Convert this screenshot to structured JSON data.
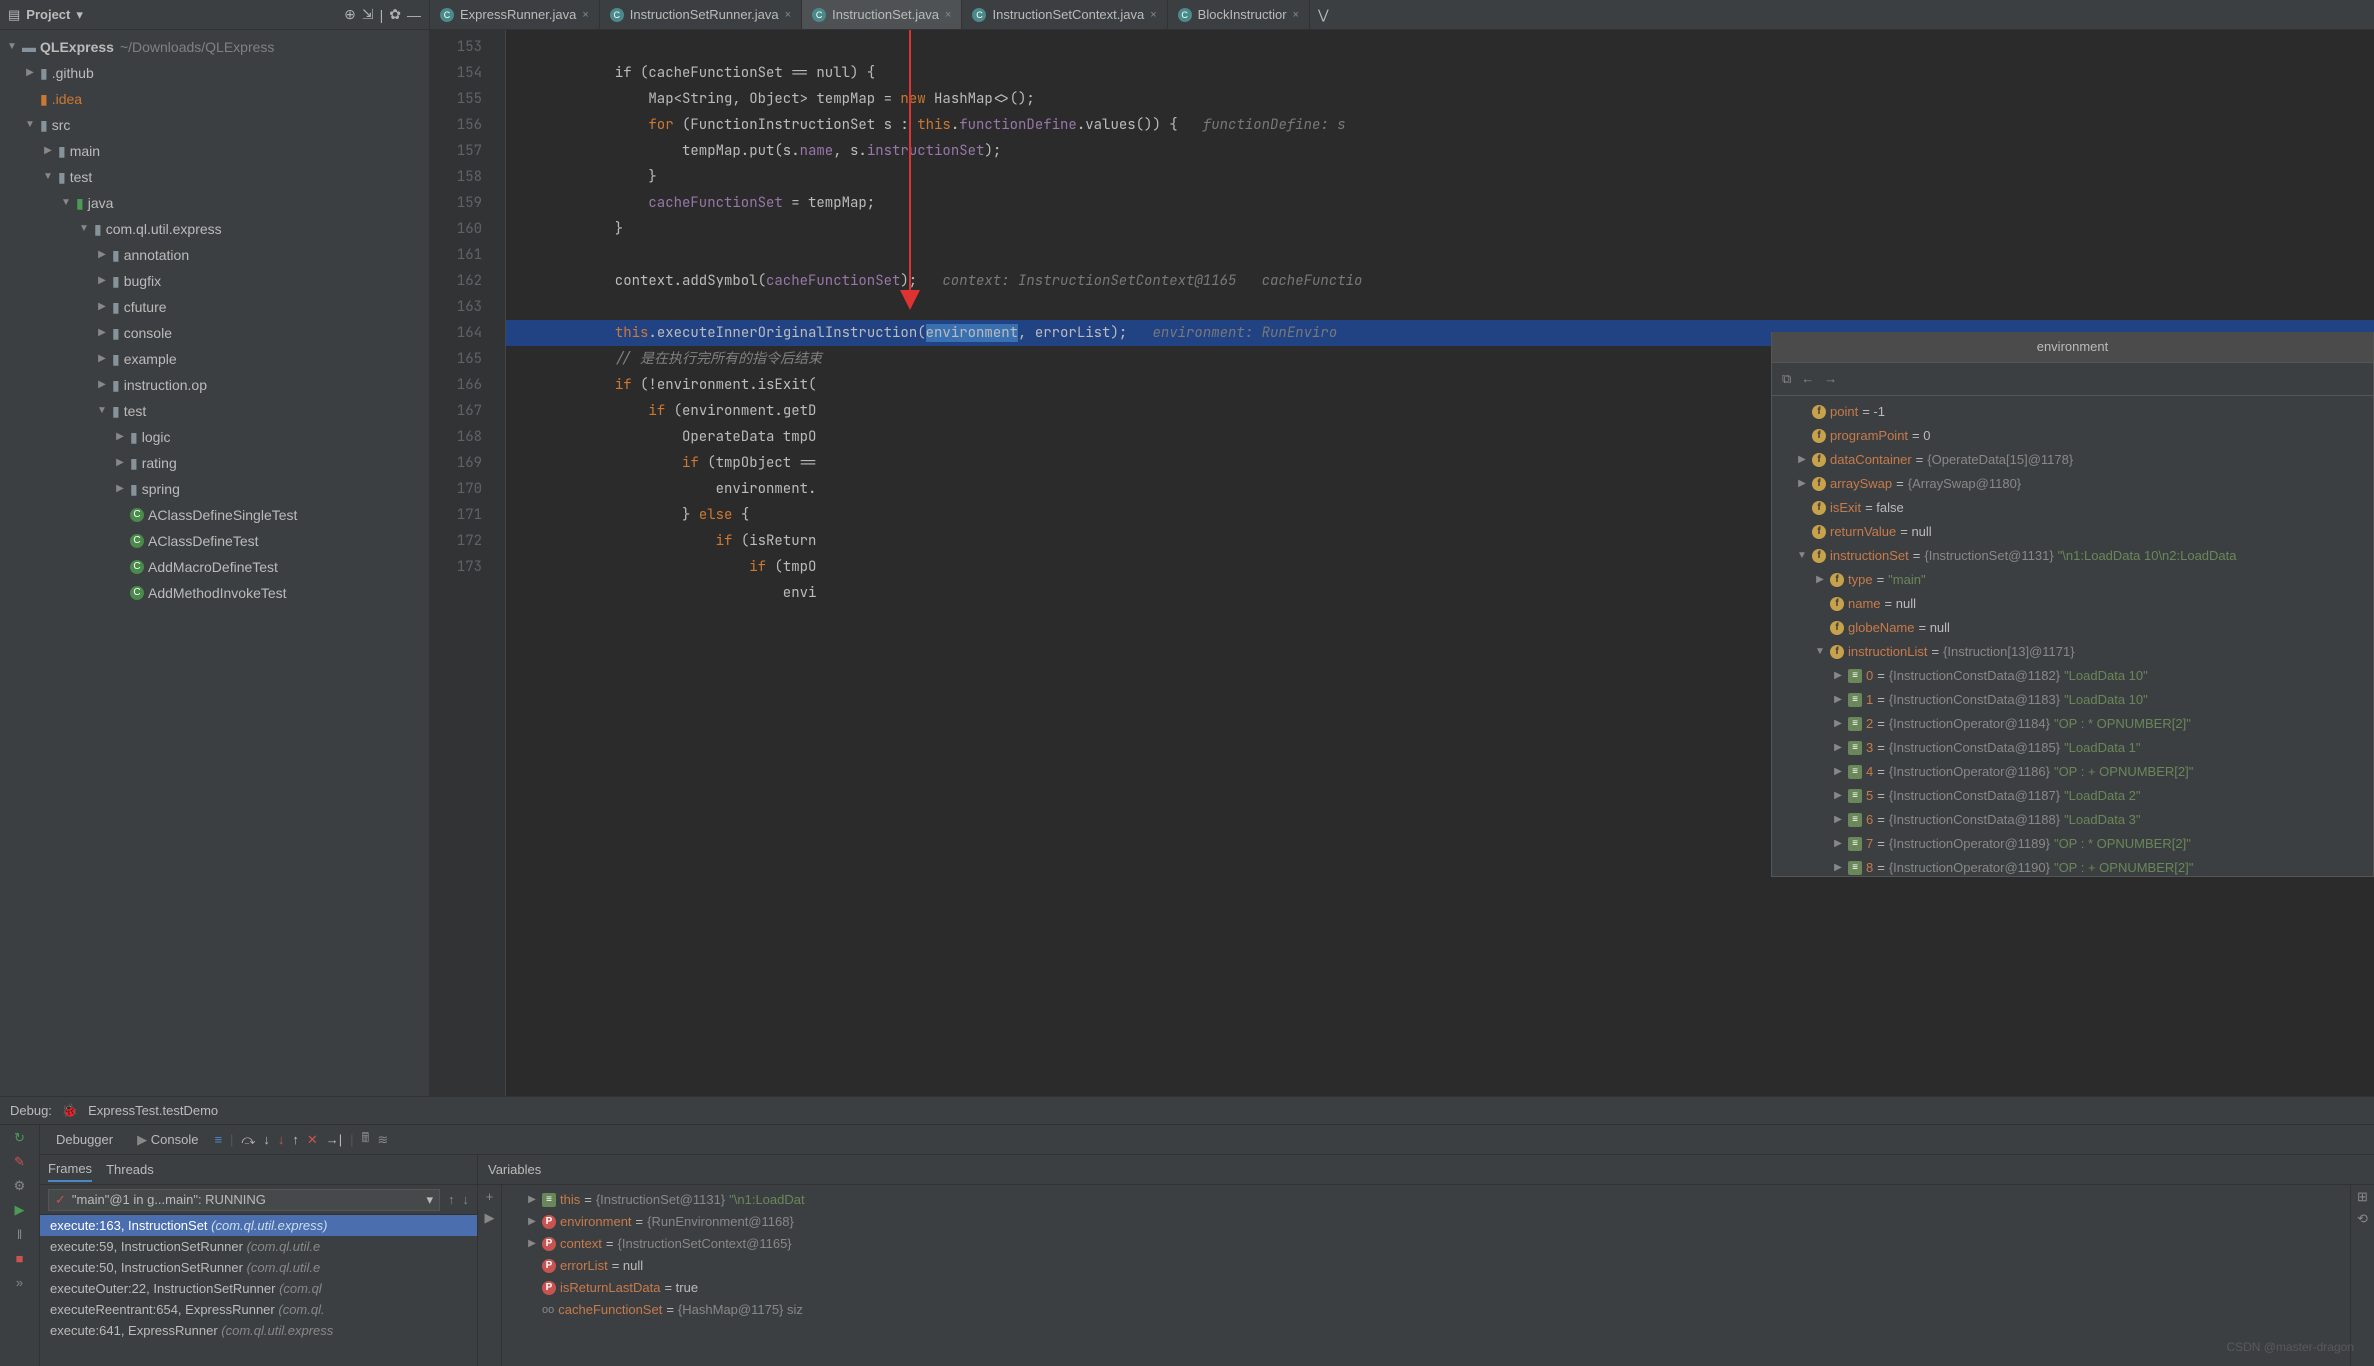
{
  "project": {
    "title": "Project",
    "root": "QLExpress",
    "rootPath": "~/Downloads/QLExpress",
    "tree": [
      {
        "indent": 1,
        "arrow": "▶",
        "icon": "folder",
        "name": ".github"
      },
      {
        "indent": 1,
        "arrow": "",
        "icon": "folder-idea",
        "name": ".idea"
      },
      {
        "indent": 1,
        "arrow": "▼",
        "icon": "folder",
        "name": "src"
      },
      {
        "indent": 2,
        "arrow": "▶",
        "icon": "folder",
        "name": "main"
      },
      {
        "indent": 2,
        "arrow": "▼",
        "icon": "folder",
        "name": "test"
      },
      {
        "indent": 3,
        "arrow": "▼",
        "icon": "folder-test",
        "name": "java"
      },
      {
        "indent": 4,
        "arrow": "▼",
        "icon": "folder",
        "name": "com.ql.util.express"
      },
      {
        "indent": 5,
        "arrow": "▶",
        "icon": "folder",
        "name": "annotation"
      },
      {
        "indent": 5,
        "arrow": "▶",
        "icon": "folder",
        "name": "bugfix"
      },
      {
        "indent": 5,
        "arrow": "▶",
        "icon": "folder",
        "name": "cfuture"
      },
      {
        "indent": 5,
        "arrow": "▶",
        "icon": "folder",
        "name": "console"
      },
      {
        "indent": 5,
        "arrow": "▶",
        "icon": "folder",
        "name": "example"
      },
      {
        "indent": 5,
        "arrow": "▶",
        "icon": "folder",
        "name": "instruction.op"
      },
      {
        "indent": 5,
        "arrow": "▼",
        "icon": "folder",
        "name": "test"
      },
      {
        "indent": 6,
        "arrow": "▶",
        "icon": "folder",
        "name": "logic"
      },
      {
        "indent": 6,
        "arrow": "▶",
        "icon": "folder",
        "name": "rating"
      },
      {
        "indent": 6,
        "arrow": "▶",
        "icon": "folder",
        "name": "spring"
      },
      {
        "indent": 6,
        "arrow": "",
        "icon": "class",
        "name": "AClassDefineSingleTest"
      },
      {
        "indent": 6,
        "arrow": "",
        "icon": "class",
        "name": "AClassDefineTest"
      },
      {
        "indent": 6,
        "arrow": "",
        "icon": "class",
        "name": "AddMacroDefineTest"
      },
      {
        "indent": 6,
        "arrow": "",
        "icon": "class",
        "name": "AddMethodInvokeTest"
      }
    ]
  },
  "tabs": [
    {
      "label": "ExpressRunner.java",
      "active": false
    },
    {
      "label": "InstructionSetRunner.java",
      "active": false
    },
    {
      "label": "InstructionSet.java",
      "active": true
    },
    {
      "label": "InstructionSetContext.java",
      "active": false
    },
    {
      "label": "BlockInstructior",
      "active": false
    }
  ],
  "gutter": [
    "153",
    "154",
    "155",
    "156",
    "157",
    "158",
    "159",
    "160",
    "161",
    "162",
    "163",
    "164",
    "165",
    "166",
    "167",
    "168",
    "169",
    "170",
    "171",
    "172",
    "173"
  ],
  "code": {
    "l153": "            if (cacheFunctionSet == null) {",
    "l154_a": "                Map<String, Object> tempMap ",
    "l154_b": "= ",
    "l154_c": "new",
    "l154_d": " HashMap<>();",
    "l155_a": "                ",
    "l155_b": "for",
    "l155_c": " (FunctionInstructionSet",
    "l155_d": " s : ",
    "l155_e": "this",
    "l155_f": ".",
    "l155_g": "functionDefine",
    "l155_h": ".values()) {   ",
    "l155_i": "functionDefine: s",
    "l156_a": "                    tempMap.put(s.",
    "l156_b": "name",
    "l156_c": ", s.",
    "l156_d": "instructionSet",
    "l156_e": ");",
    "l157": "                }",
    "l158_a": "                ",
    "l158_b": "cacheFunctionSet",
    "l158_c": " = tempMap;",
    "l159": "            }",
    "l160": "",
    "l161_a": "            context.addSymbol(",
    "l161_b": "cacheFunctionSet",
    "l161_c": ");   ",
    "l161_d": "context: InstructionSetContext@1165   cacheFunctio",
    "l162": "",
    "l163_a": "            ",
    "l163_b": "this",
    "l163_c": ".executeInnerOriginalInstruction(",
    "l163_d": "environment",
    "l163_e": ", errorList",
    "l163_f": ");   ",
    "l163_g": "environment: RunEnviro",
    "l164_a": "            ",
    "l164_b": "// 是在执行完所有的指令后结束",
    "l165_a": "            ",
    "l165_b": "if",
    "l165_c": " (!environment.isExit(",
    "l166_a": "                ",
    "l166_b": "if",
    "l166_c": " (environment.getD",
    "l167": "                    OperateData tmpO",
    "l168_a": "                    ",
    "l168_b": "if",
    "l168_c": " (tmpObject ==",
    "l169": "                        environment.",
    "l170_a": "                    } ",
    "l170_b": "else",
    "l170_c": " {",
    "l171_a": "                        ",
    "l171_b": "if",
    "l171_c": " (isReturn",
    "l172_a": "                            ",
    "l172_b": "if",
    "l172_c": " (tmpO",
    "l173": "                                envi"
  },
  "popup": {
    "title": "environment",
    "rows": [
      {
        "i": 1,
        "arr": "",
        "b": "f",
        "name": "point",
        "val": " = -1"
      },
      {
        "i": 1,
        "arr": "",
        "b": "f",
        "name": "programPoint",
        "val": " = 0"
      },
      {
        "i": 1,
        "arr": "▶",
        "b": "f",
        "name": "dataContainer",
        "val": " = ",
        "gr": "{OperateData[15]@1178}"
      },
      {
        "i": 1,
        "arr": "▶",
        "b": "f",
        "name": "arraySwap",
        "val": " = ",
        "gr": "{ArraySwap@1180}"
      },
      {
        "i": 1,
        "arr": "",
        "b": "f",
        "name": "isExit",
        "val": " = false"
      },
      {
        "i": 1,
        "arr": "",
        "b": "f",
        "name": "returnValue",
        "val": " = null",
        "flag": true
      },
      {
        "i": 1,
        "arr": "▼",
        "b": "f",
        "name": "instructionSet",
        "val": " = ",
        "gr": "{InstructionSet@1131} ",
        "sv": "\"\\n1:LoadData 10\\n2:LoadData"
      },
      {
        "i": 2,
        "arr": "▶",
        "b": "f",
        "name": "type",
        "val": " = ",
        "sv": "\"main\""
      },
      {
        "i": 2,
        "arr": "",
        "b": "f",
        "name": "name",
        "val": " = null"
      },
      {
        "i": 2,
        "arr": "",
        "b": "f",
        "name": "globeName",
        "val": " = null"
      },
      {
        "i": 2,
        "arr": "▼",
        "b": "f",
        "name": "instructionList",
        "val": " = ",
        "gr": "{Instruction[13]@1171}"
      },
      {
        "i": 3,
        "arr": "▶",
        "b": "e",
        "name": "0",
        "val": " = ",
        "gr": "{InstructionConstData@1182} ",
        "sv": "\"LoadData 10\""
      },
      {
        "i": 3,
        "arr": "▶",
        "b": "e",
        "name": "1",
        "val": " = ",
        "gr": "{InstructionConstData@1183} ",
        "sv": "\"LoadData 10\""
      },
      {
        "i": 3,
        "arr": "▶",
        "b": "e",
        "name": "2",
        "val": " = ",
        "gr": "{InstructionOperator@1184} ",
        "sv": "\"OP : * OPNUMBER[2]\""
      },
      {
        "i": 3,
        "arr": "▶",
        "b": "e",
        "name": "3",
        "val": " = ",
        "gr": "{InstructionConstData@1185} ",
        "sv": "\"LoadData 1\""
      },
      {
        "i": 3,
        "arr": "▶",
        "b": "e",
        "name": "4",
        "val": " = ",
        "gr": "{InstructionOperator@1186} ",
        "sv": "\"OP : + OPNUMBER[2]\""
      },
      {
        "i": 3,
        "arr": "▶",
        "b": "e",
        "name": "5",
        "val": " = ",
        "gr": "{InstructionConstData@1187} ",
        "sv": "\"LoadData 2\""
      },
      {
        "i": 3,
        "arr": "▶",
        "b": "e",
        "name": "6",
        "val": " = ",
        "gr": "{InstructionConstData@1188} ",
        "sv": "\"LoadData 3\""
      },
      {
        "i": 3,
        "arr": "▶",
        "b": "e",
        "name": "7",
        "val": " = ",
        "gr": "{InstructionOperator@1189} ",
        "sv": "\"OP : * OPNUMBER[2]\""
      },
      {
        "i": 3,
        "arr": "▶",
        "b": "e",
        "name": "8",
        "val": " = ",
        "gr": "{InstructionOperator@1190} ",
        "sv": "\"OP : + OPNUMBER[2]\""
      }
    ]
  },
  "debug": {
    "label": "Debug:",
    "config": "ExpressTest.testDemo",
    "tabs": {
      "debugger": "Debugger",
      "console": "Console"
    },
    "frames_tab": "Frames",
    "threads_tab": "Threads",
    "vars_tab": "Variables",
    "thread": "\"main\"@1 in g...main\": RUNNING",
    "frames": [
      {
        "sel": true,
        "text": "execute:163, InstructionSet ",
        "loc": "(com.ql.util.express)"
      },
      {
        "sel": false,
        "text": "execute:59, InstructionSetRunner ",
        "loc": "(com.ql.util.e"
      },
      {
        "sel": false,
        "text": "execute:50, InstructionSetRunner ",
        "loc": "(com.ql.util.e"
      },
      {
        "sel": false,
        "text": "executeOuter:22, InstructionSetRunner ",
        "loc": "(com.ql"
      },
      {
        "sel": false,
        "text": "executeReentrant:654, ExpressRunner ",
        "loc": "(com.ql."
      },
      {
        "sel": false,
        "text": "execute:641, ExpressRunner ",
        "loc": "(com.ql.util.express"
      }
    ],
    "vars": [
      {
        "i": 1,
        "arr": "▶",
        "b": "e",
        "name": "this",
        "val": " = ",
        "gr": "{InstructionSet@1131} ",
        "sv": "\"\\n1:LoadDat"
      },
      {
        "i": 1,
        "arr": "▶",
        "b": "p",
        "name": "environment",
        "val": " = ",
        "gr": "{RunEnvironment@1168}"
      },
      {
        "i": 1,
        "arr": "▶",
        "b": "p",
        "name": "context",
        "val": " = ",
        "gr": "{InstructionSetContext@1165}"
      },
      {
        "i": 1,
        "arr": "",
        "b": "p",
        "name": "errorList",
        "val": " = null"
      },
      {
        "i": 1,
        "arr": "",
        "b": "p",
        "name": "isReturnLastData",
        "val": " = true"
      },
      {
        "i": 1,
        "arr": "",
        "b": "oo",
        "name": "cacheFunctionSet",
        "val": " = ",
        "gr": "{HashMap@1175}  siz"
      }
    ]
  },
  "watermark": "CSDN @master-dragon"
}
